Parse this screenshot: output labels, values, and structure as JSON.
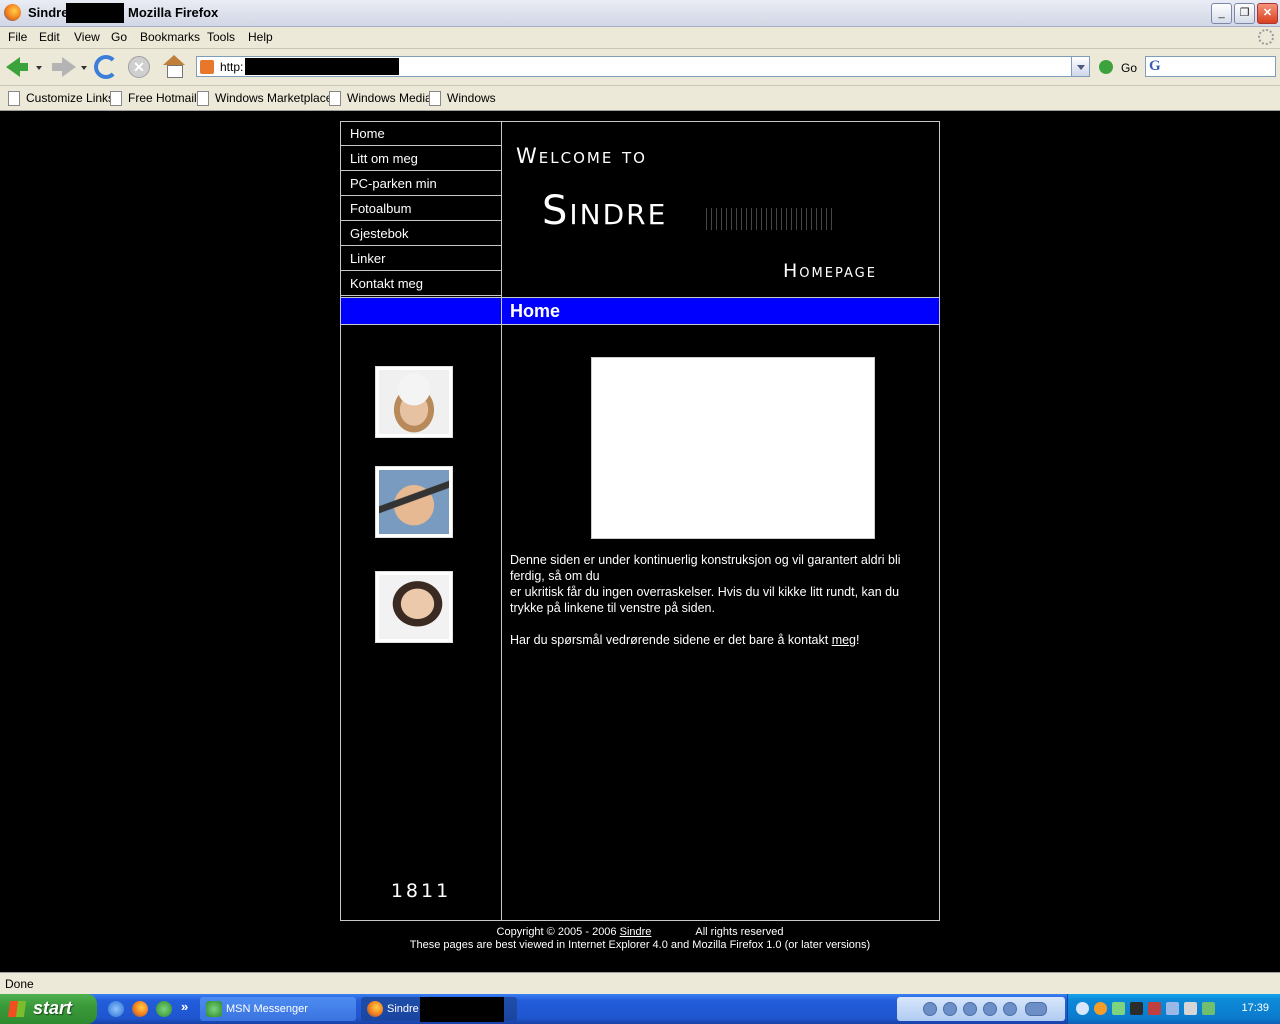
{
  "window": {
    "title_prefix": "Sindre",
    "title_suffix": "Mozilla Firefox",
    "buttons": {
      "minimize": "_",
      "restore": "❐",
      "close": "✕"
    }
  },
  "menu": [
    "File",
    "Edit",
    "View",
    "Go",
    "Bookmarks",
    "Tools",
    "Help"
  ],
  "navbar": {
    "url_prefix": "http:",
    "go_label": "Go",
    "stop_glyph": "✕"
  },
  "bookmarks": [
    "Customize Links",
    "Free Hotmail",
    "Windows Marketplace",
    "Windows Media",
    "Windows"
  ],
  "site": {
    "nav": [
      "Home",
      "Litt om meg",
      "PC-parken min",
      "Fotoalbum",
      "Gjestebok",
      "Linker",
      "Kontakt meg"
    ],
    "header": {
      "welcome": "Welcome to",
      "name": "Sindre",
      "homepage": "Homepage"
    },
    "section_title": "Home",
    "counter": "1811",
    "body": {
      "p1_line1": "Denne siden er under kontinuerlig konstruksjon og vil garantert aldri bli ferdig, så om du",
      "p1_line2": "er ukritisk får du ingen overraskelser. Hvis du vil kikke litt rundt, kan du trykke på linkene til venstre på siden.",
      "p2_before": "Har du spørsmål vedrørende sidene er det bare å kontakt ",
      "p2_link": "meg",
      "p2_after": "!"
    },
    "footer": {
      "copyright_before": "Copyright © 2005 - 2006 ",
      "copyright_link": "Sindre",
      "rights": "All rights reserved",
      "best_viewed": "These pages are best viewed in Internet Explorer 4.0 and Mozilla Firefox 1.0 (or later versions)"
    }
  },
  "status": "Done",
  "taskbar": {
    "start": "start",
    "quicklaunch_more": "»",
    "tasks": [
      "MSN Messenger",
      "Sindre"
    ],
    "clock": "17:39"
  },
  "colors": {
    "section_bar": "#0000ff",
    "page_bg": "#000000",
    "text": "#ffffff"
  }
}
